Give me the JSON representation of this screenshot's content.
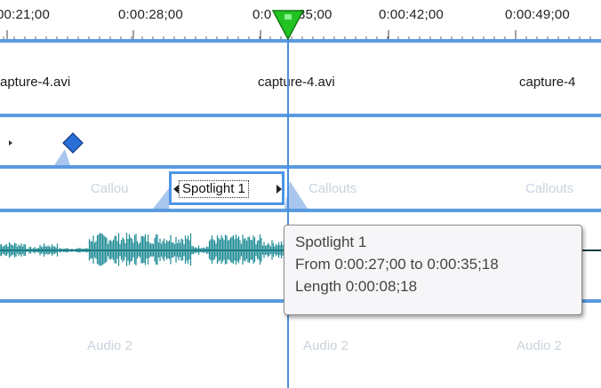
{
  "ruler": {
    "times": [
      "00:21;00",
      "0:00:28;00",
      "0:0",
      "35;00",
      "0:00:42;00",
      "0:00:49;00"
    ]
  },
  "video_track": {
    "clips": [
      "apture-4.avi",
      "capture-4.avi",
      "capture-4"
    ]
  },
  "callouts_track": {
    "ghost_labels": [
      "Callou",
      "Callouts",
      "Callouts"
    ],
    "selected_clip": "Spotlight 1"
  },
  "audio_track_2": {
    "labels": [
      "Audio 2",
      "Audio 2",
      "Audio 2"
    ]
  },
  "tooltip": {
    "title": "Spotlight 1",
    "from_line": "From 0:00:27;00 to 0:00:35;18",
    "length_line": "Length 0:00:08;18"
  },
  "colors": {
    "track_separator": "#5a9be0",
    "playhead_marker": "#22c322",
    "waveform": "#1f8c95",
    "keyframe": "#2a6fd8"
  },
  "icons": {
    "playhead": "playhead-marker-icon",
    "keyframe": "keyframe-diamond-icon"
  }
}
